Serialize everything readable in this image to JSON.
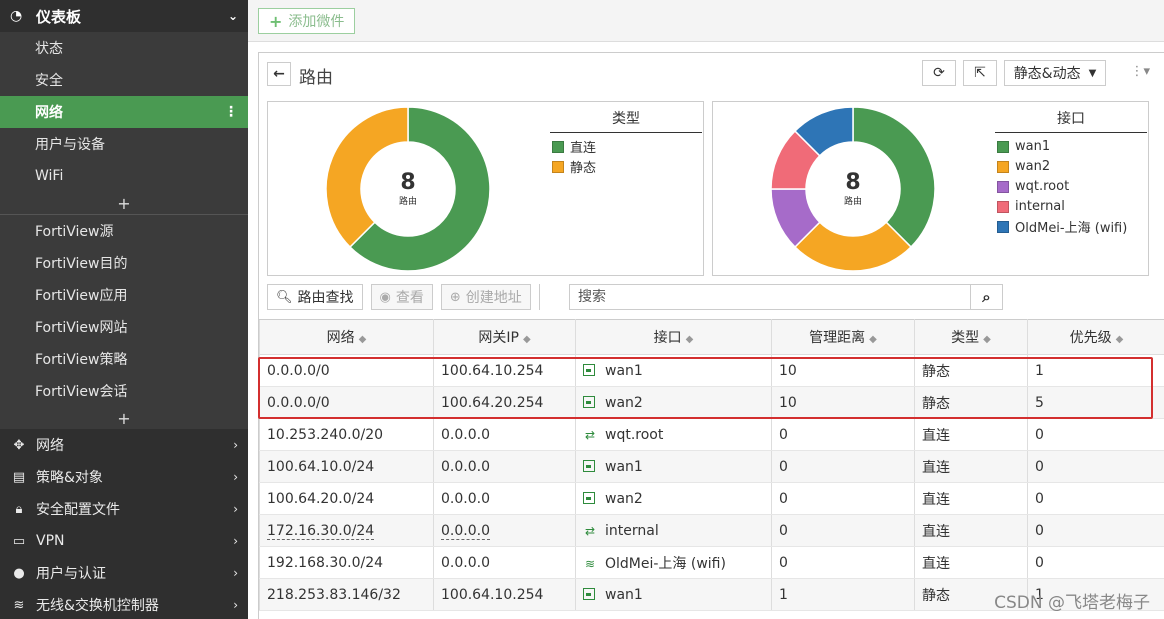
{
  "sidebar": {
    "dashboard": "仪表板",
    "items": [
      "状态",
      "安全",
      "网络",
      "用户与设备",
      "WiFi"
    ],
    "fortiview": [
      "FortiView源",
      "FortiView目的",
      "FortiView应用",
      "FortiView网站",
      "FortiView策略",
      "FortiView会话"
    ],
    "menus": [
      "网络",
      "策略&对象",
      "安全配置文件",
      "VPN",
      "用户与认证",
      "无线&交换机控制器"
    ]
  },
  "topbar": {
    "add_widget": "添加微件"
  },
  "widget": {
    "title": "路由",
    "view_select": "静态&动态",
    "chart1": {
      "center_value": "8",
      "center_label": "路由",
      "legend_title": "类型",
      "legend": [
        {
          "label": "直连",
          "color": "#4a9a52"
        },
        {
          "label": "静态",
          "color": "#f5a623"
        }
      ]
    },
    "chart2": {
      "center_value": "8",
      "center_label": "路由",
      "legend_title": "接口",
      "legend": [
        {
          "label": "wan1",
          "color": "#4a9a52"
        },
        {
          "label": "wan2",
          "color": "#f5a623"
        },
        {
          "label": "wqt.root",
          "color": "#a66bc9"
        },
        {
          "label": "internal",
          "color": "#f06b78"
        },
        {
          "label": "OldMei-上海 (wifi)",
          "color": "#2e75b6"
        }
      ]
    },
    "toolbar": {
      "route_lookup": "路由查找",
      "view": "查看",
      "create_address": "创建地址",
      "search_placeholder": "搜索"
    }
  },
  "chart_data": [
    {
      "type": "pie",
      "categories": [
        "直连",
        "静态"
      ],
      "values": [
        5,
        3
      ],
      "legend_title": "类型"
    },
    {
      "type": "pie",
      "categories": [
        "wan1",
        "wan2",
        "wqt.root",
        "internal",
        "OldMei-上海 (wifi)"
      ],
      "values": [
        3,
        2,
        1,
        1,
        1
      ],
      "legend_title": "接口"
    }
  ],
  "table": {
    "headers": [
      "网络",
      "网关IP",
      "接口",
      "管理距离",
      "类型",
      "优先级"
    ],
    "rows": [
      {
        "network": "0.0.0.0/0",
        "gateway": "100.64.10.254",
        "iface": "wan1",
        "icon": "port",
        "distance": "10",
        "type": "静态",
        "priority": "1"
      },
      {
        "network": "0.0.0.0/0",
        "gateway": "100.64.20.254",
        "iface": "wan2",
        "icon": "port",
        "distance": "10",
        "type": "静态",
        "priority": "5"
      },
      {
        "network": "10.253.240.0/20",
        "gateway": "0.0.0.0",
        "iface": "wqt.root",
        "icon": "shuffle",
        "distance": "0",
        "type": "直连",
        "priority": "0"
      },
      {
        "network": "100.64.10.0/24",
        "gateway": "0.0.0.0",
        "iface": "wan1",
        "icon": "port",
        "distance": "0",
        "type": "直连",
        "priority": "0"
      },
      {
        "network": "100.64.20.0/24",
        "gateway": "0.0.0.0",
        "iface": "wan2",
        "icon": "port",
        "distance": "0",
        "type": "直连",
        "priority": "0"
      },
      {
        "network": "172.16.30.0/24",
        "gateway": "0.0.0.0",
        "iface": "internal",
        "icon": "shuffle",
        "distance": "0",
        "type": "直连",
        "priority": "0"
      },
      {
        "network": "192.168.30.0/24",
        "gateway": "0.0.0.0",
        "iface": "OldMei-上海 (wifi)",
        "icon": "wifi",
        "distance": "0",
        "type": "直连",
        "priority": "0"
      },
      {
        "network": "218.253.83.146/32",
        "gateway": "100.64.10.254",
        "iface": "wan1",
        "icon": "port",
        "distance": "1",
        "type": "静态",
        "priority": "1"
      }
    ]
  },
  "watermark": "CSDN @飞塔老梅子"
}
